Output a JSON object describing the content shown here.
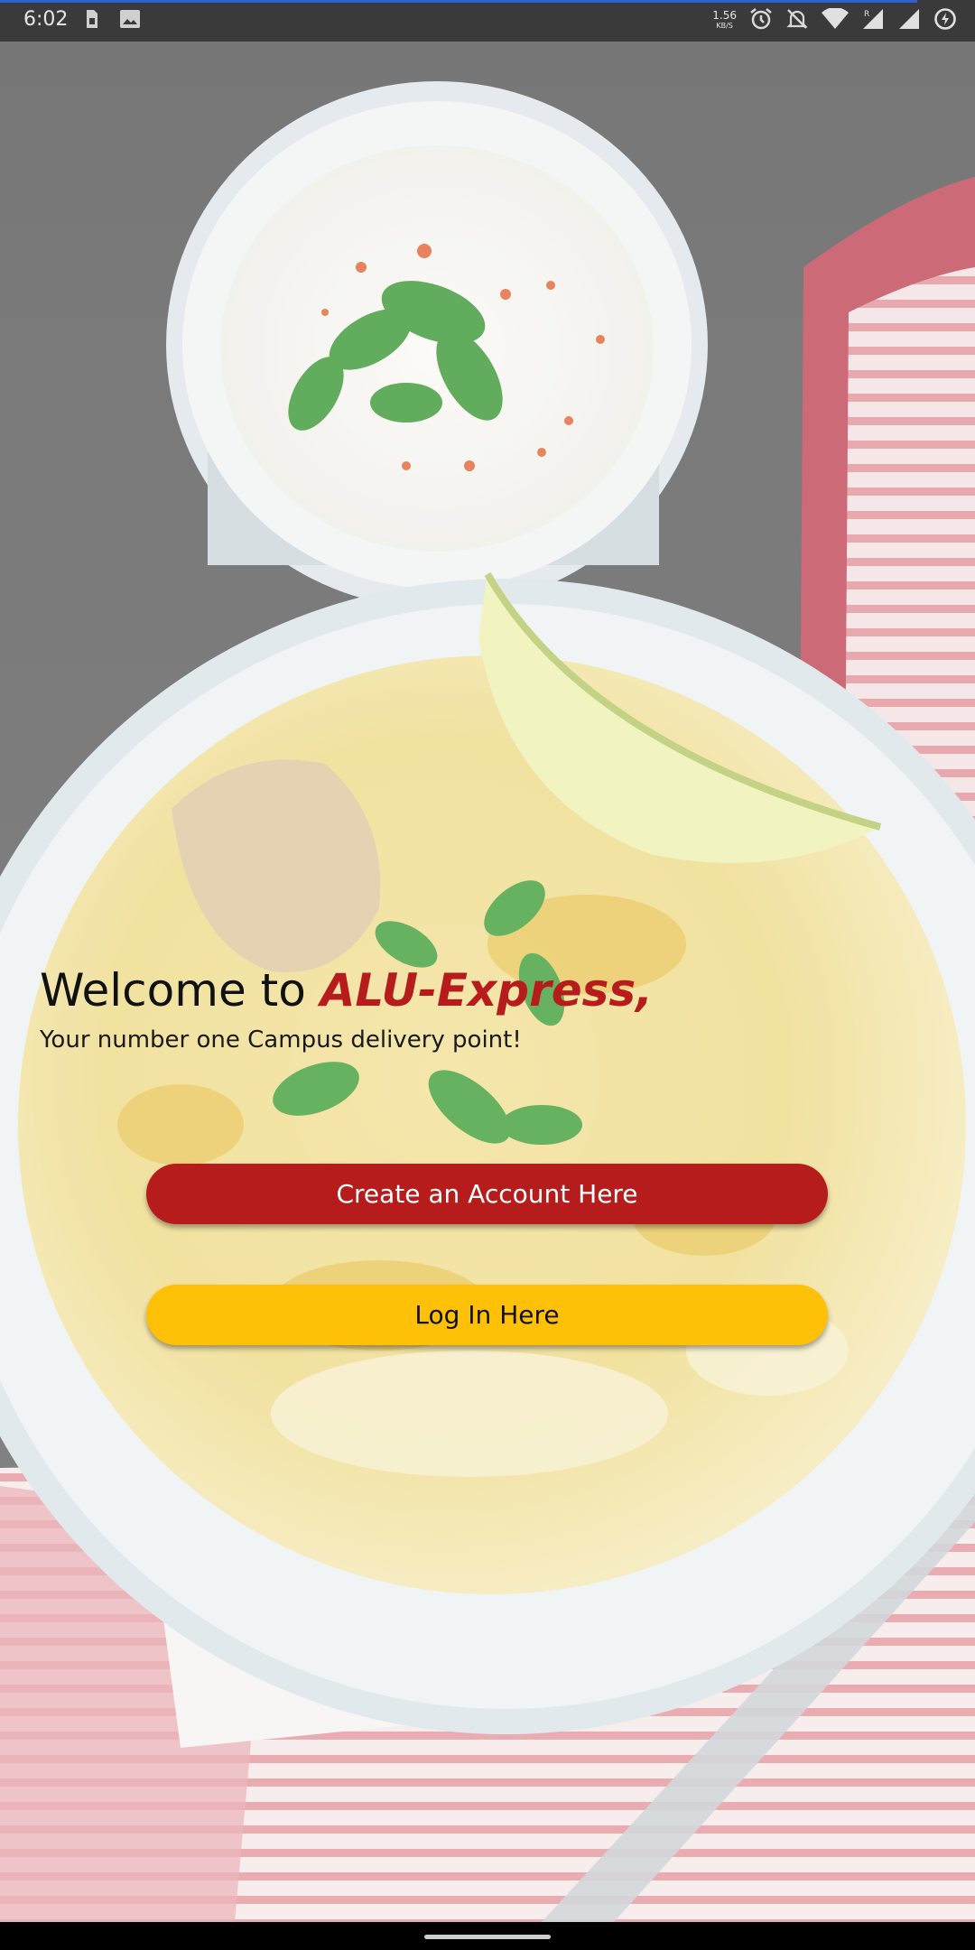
{
  "status_bar": {
    "time": "6:02",
    "net_speed_value": "1.56",
    "net_speed_unit": "KB/S",
    "icons": [
      "sim-card-icon",
      "image-icon",
      "alarm-icon",
      "notifications-off-icon",
      "wifi-icon",
      "signal-icon",
      "signal-roaming-icon",
      "battery-saver-icon"
    ]
  },
  "welcome": {
    "prefix": "Welcome to ",
    "brand": "ALU-Express,",
    "tagline": "Your number one Campus delivery point!"
  },
  "buttons": {
    "create_account": "Create an Account Here",
    "log_in": "Log In Here"
  },
  "colors": {
    "brand_red": "#b71c1c",
    "login_yellow": "#ffc107",
    "status_accent": "#2f5fd0"
  }
}
